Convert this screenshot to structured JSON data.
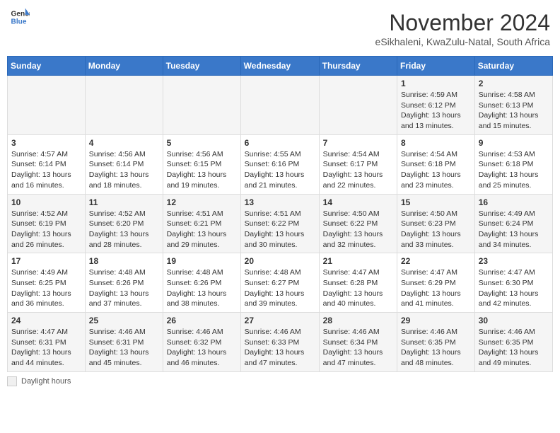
{
  "header": {
    "logo_line1": "General",
    "logo_line2": "Blue",
    "month": "November 2024",
    "location": "eSikhaleni, KwaZulu-Natal, South Africa"
  },
  "weekdays": [
    "Sunday",
    "Monday",
    "Tuesday",
    "Wednesday",
    "Thursday",
    "Friday",
    "Saturday"
  ],
  "weeks": [
    [
      {
        "day": "",
        "info": ""
      },
      {
        "day": "",
        "info": ""
      },
      {
        "day": "",
        "info": ""
      },
      {
        "day": "",
        "info": ""
      },
      {
        "day": "",
        "info": ""
      },
      {
        "day": "1",
        "info": "Sunrise: 4:59 AM\nSunset: 6:12 PM\nDaylight: 13 hours\nand 13 minutes."
      },
      {
        "day": "2",
        "info": "Sunrise: 4:58 AM\nSunset: 6:13 PM\nDaylight: 13 hours\nand 15 minutes."
      }
    ],
    [
      {
        "day": "3",
        "info": "Sunrise: 4:57 AM\nSunset: 6:14 PM\nDaylight: 13 hours\nand 16 minutes."
      },
      {
        "day": "4",
        "info": "Sunrise: 4:56 AM\nSunset: 6:14 PM\nDaylight: 13 hours\nand 18 minutes."
      },
      {
        "day": "5",
        "info": "Sunrise: 4:56 AM\nSunset: 6:15 PM\nDaylight: 13 hours\nand 19 minutes."
      },
      {
        "day": "6",
        "info": "Sunrise: 4:55 AM\nSunset: 6:16 PM\nDaylight: 13 hours\nand 21 minutes."
      },
      {
        "day": "7",
        "info": "Sunrise: 4:54 AM\nSunset: 6:17 PM\nDaylight: 13 hours\nand 22 minutes."
      },
      {
        "day": "8",
        "info": "Sunrise: 4:54 AM\nSunset: 6:18 PM\nDaylight: 13 hours\nand 23 minutes."
      },
      {
        "day": "9",
        "info": "Sunrise: 4:53 AM\nSunset: 6:18 PM\nDaylight: 13 hours\nand 25 minutes."
      }
    ],
    [
      {
        "day": "10",
        "info": "Sunrise: 4:52 AM\nSunset: 6:19 PM\nDaylight: 13 hours\nand 26 minutes."
      },
      {
        "day": "11",
        "info": "Sunrise: 4:52 AM\nSunset: 6:20 PM\nDaylight: 13 hours\nand 28 minutes."
      },
      {
        "day": "12",
        "info": "Sunrise: 4:51 AM\nSunset: 6:21 PM\nDaylight: 13 hours\nand 29 minutes."
      },
      {
        "day": "13",
        "info": "Sunrise: 4:51 AM\nSunset: 6:22 PM\nDaylight: 13 hours\nand 30 minutes."
      },
      {
        "day": "14",
        "info": "Sunrise: 4:50 AM\nSunset: 6:22 PM\nDaylight: 13 hours\nand 32 minutes."
      },
      {
        "day": "15",
        "info": "Sunrise: 4:50 AM\nSunset: 6:23 PM\nDaylight: 13 hours\nand 33 minutes."
      },
      {
        "day": "16",
        "info": "Sunrise: 4:49 AM\nSunset: 6:24 PM\nDaylight: 13 hours\nand 34 minutes."
      }
    ],
    [
      {
        "day": "17",
        "info": "Sunrise: 4:49 AM\nSunset: 6:25 PM\nDaylight: 13 hours\nand 36 minutes."
      },
      {
        "day": "18",
        "info": "Sunrise: 4:48 AM\nSunset: 6:26 PM\nDaylight: 13 hours\nand 37 minutes."
      },
      {
        "day": "19",
        "info": "Sunrise: 4:48 AM\nSunset: 6:26 PM\nDaylight: 13 hours\nand 38 minutes."
      },
      {
        "day": "20",
        "info": "Sunrise: 4:48 AM\nSunset: 6:27 PM\nDaylight: 13 hours\nand 39 minutes."
      },
      {
        "day": "21",
        "info": "Sunrise: 4:47 AM\nSunset: 6:28 PM\nDaylight: 13 hours\nand 40 minutes."
      },
      {
        "day": "22",
        "info": "Sunrise: 4:47 AM\nSunset: 6:29 PM\nDaylight: 13 hours\nand 41 minutes."
      },
      {
        "day": "23",
        "info": "Sunrise: 4:47 AM\nSunset: 6:30 PM\nDaylight: 13 hours\nand 42 minutes."
      }
    ],
    [
      {
        "day": "24",
        "info": "Sunrise: 4:47 AM\nSunset: 6:31 PM\nDaylight: 13 hours\nand 44 minutes."
      },
      {
        "day": "25",
        "info": "Sunrise: 4:46 AM\nSunset: 6:31 PM\nDaylight: 13 hours\nand 45 minutes."
      },
      {
        "day": "26",
        "info": "Sunrise: 4:46 AM\nSunset: 6:32 PM\nDaylight: 13 hours\nand 46 minutes."
      },
      {
        "day": "27",
        "info": "Sunrise: 4:46 AM\nSunset: 6:33 PM\nDaylight: 13 hours\nand 47 minutes."
      },
      {
        "day": "28",
        "info": "Sunrise: 4:46 AM\nSunset: 6:34 PM\nDaylight: 13 hours\nand 47 minutes."
      },
      {
        "day": "29",
        "info": "Sunrise: 4:46 AM\nSunset: 6:35 PM\nDaylight: 13 hours\nand 48 minutes."
      },
      {
        "day": "30",
        "info": "Sunrise: 4:46 AM\nSunset: 6:35 PM\nDaylight: 13 hours\nand 49 minutes."
      }
    ]
  ],
  "legend": {
    "box_label": "Daylight hours"
  }
}
